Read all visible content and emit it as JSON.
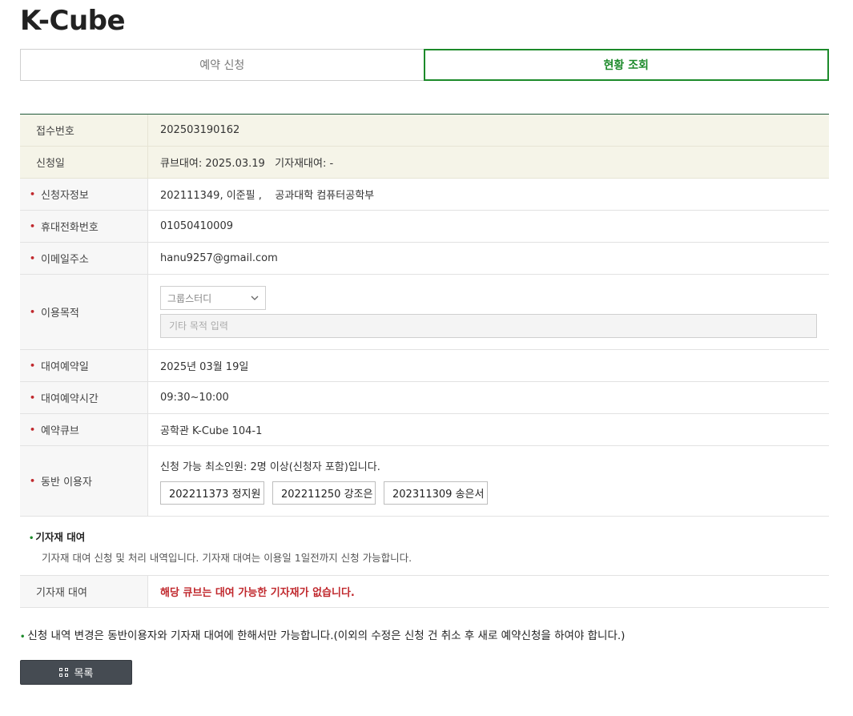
{
  "page": {
    "title": "K-Cube"
  },
  "tabs": [
    {
      "label": "예약 신청",
      "active": false
    },
    {
      "label": "현황 조회",
      "active": true
    }
  ],
  "info": {
    "receipt_no": {
      "label": "접수번호",
      "value": "202503190162"
    },
    "apply_date": {
      "label": "신청일",
      "value": "큐브대여: 2025.03.19   기자재대여: -"
    },
    "applicant": {
      "label": "신청자정보",
      "value": "202111349, 이준필 ,    공과대학 컴퓨터공학부"
    },
    "phone": {
      "label": "휴대전화번호",
      "value": "01050410009"
    },
    "email": {
      "label": "이메일주소",
      "value": "hanu9257@gmail.com"
    },
    "purpose": {
      "label": "이용목적",
      "selected": "그룹스터디",
      "other_placeholder": "기타 목적 입력"
    },
    "rental_date": {
      "label": "대여예약일",
      "value": "2025년 03월 19일"
    },
    "rental_time": {
      "label": "대여예약시간",
      "value": "09:30~10:00"
    },
    "cube": {
      "label": "예약큐브",
      "value": "공학관 K-Cube 104-1"
    },
    "companions": {
      "label": "동반 이용자",
      "note": "신청 가능 최소인원: 2명 이상(신청자 포함)입니다.",
      "list": [
        "202211373   정지원",
        "202211250   강조은",
        "202311309   송은서"
      ]
    }
  },
  "equipment": {
    "section_title": "기자재 대여",
    "section_desc": "기자재 대여 신청 및 처리 내역입니다. 기자재 대여는 이용일 1일전까지 신청 가능합니다.",
    "label": "기자재 대여",
    "value": "해당 큐브는 대여 가능한 기자재가 없습니다.",
    "value_color": "#c0282d"
  },
  "notice": "신청 내역 변경은 동반이용자와 기자재 대여에 한해서만 가능합니다.(이외의 수정은 신청 건 취소 후 새로 예약신청을 하여야 합니다.)",
  "buttons": {
    "list_label": "목록"
  },
  "icons": {
    "list_button": "grid-icon",
    "select": "chevron-down-icon"
  },
  "colors": {
    "accent": "#1c8a2a",
    "required": "#c0282d",
    "header_line": "#1f5a3a",
    "button_bg": "#454b52"
  }
}
